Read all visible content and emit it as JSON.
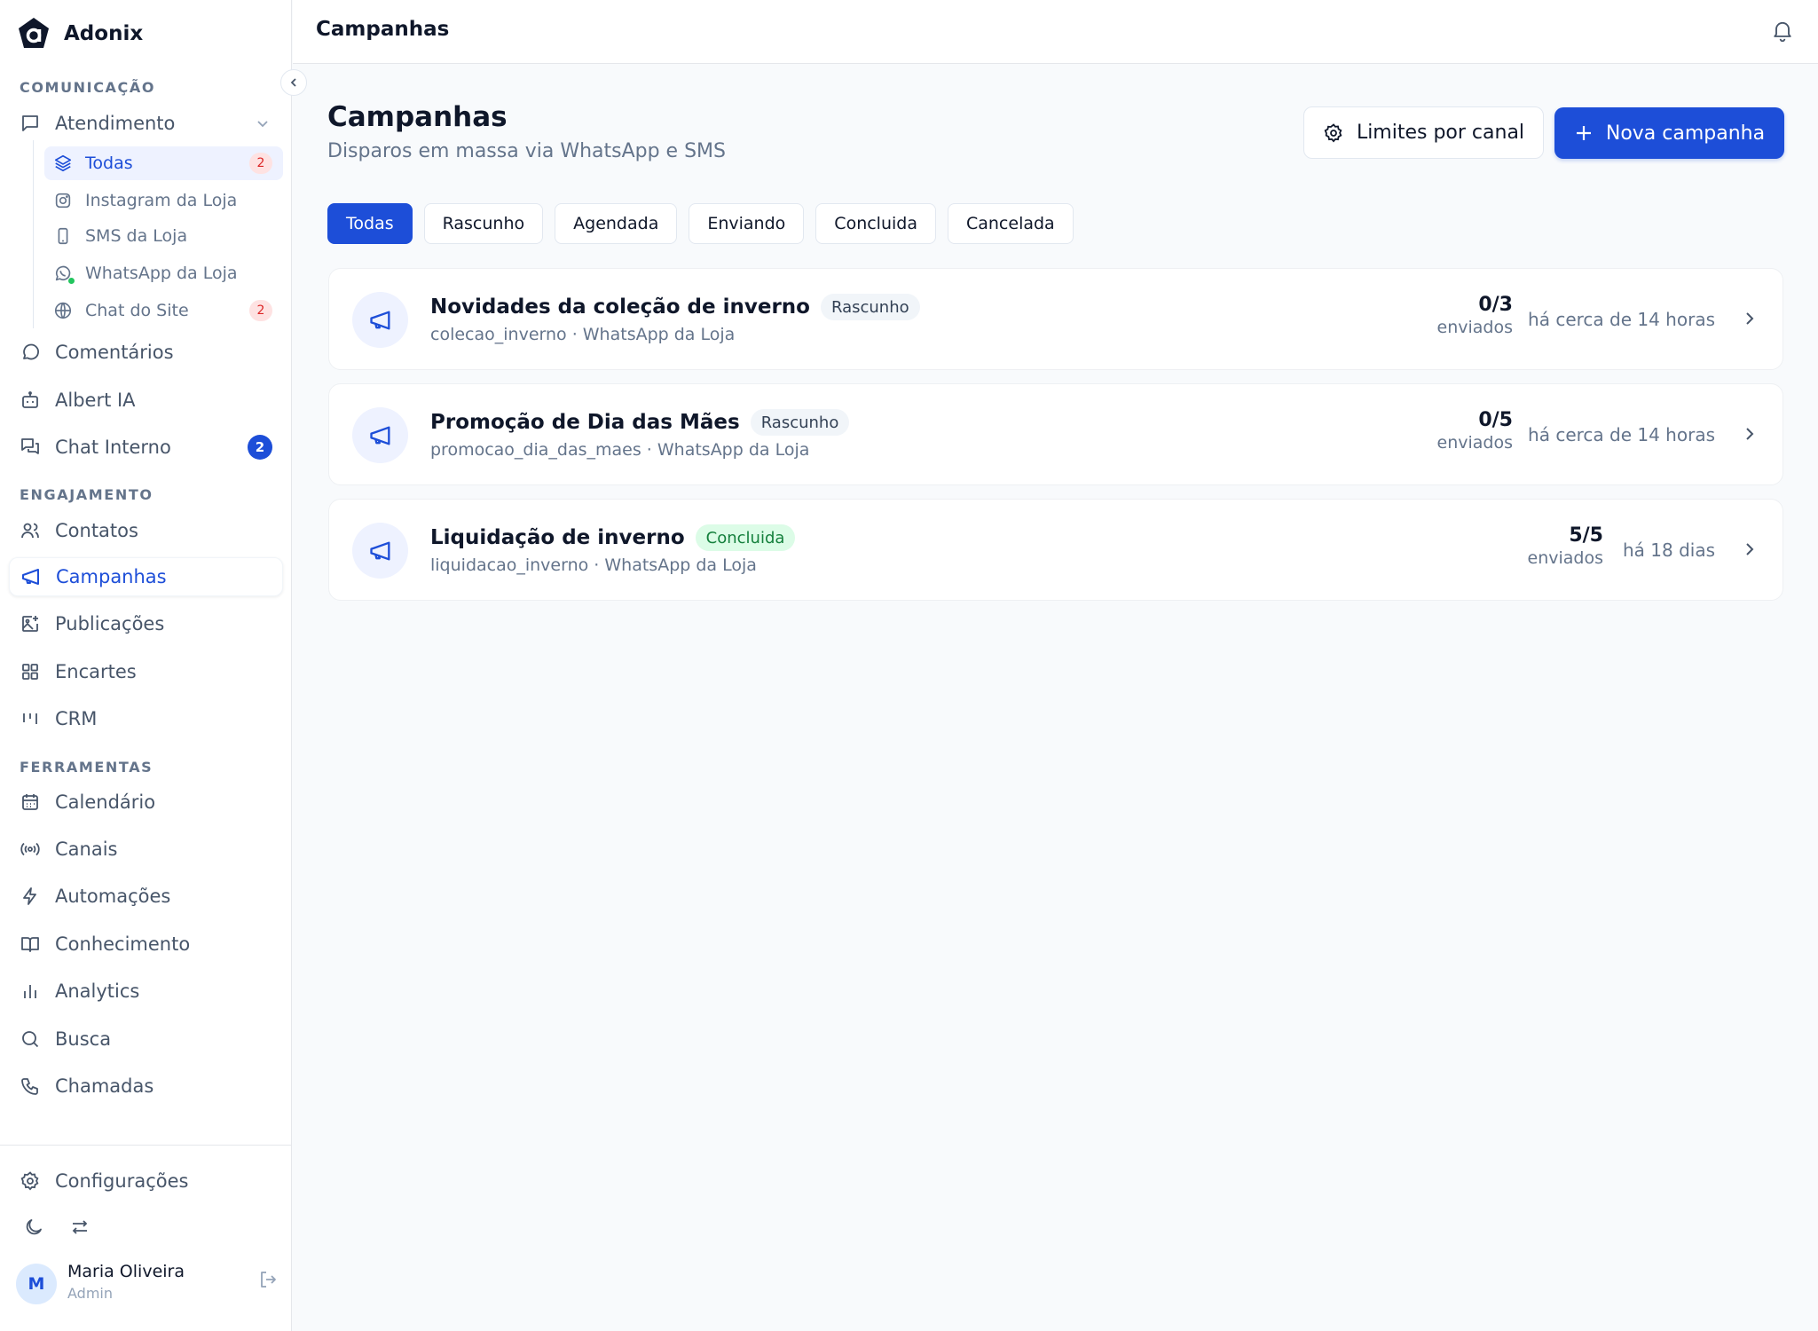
{
  "app": {
    "name": "Adonix"
  },
  "header": {
    "title": "Campanhas"
  },
  "sidebar": {
    "sections": {
      "comunicacao": "COMUNICAÇÃO",
      "engajamento": "ENGAJAMENTO",
      "ferramentas": "FERRAMENTAS"
    },
    "atendimento": {
      "label": "Atendimento",
      "subitems": [
        {
          "label": "Todas",
          "badge": "2",
          "icon": "layers-icon"
        },
        {
          "label": "Instagram da Loja",
          "icon": "instagram-icon"
        },
        {
          "label": "SMS da Loja",
          "icon": "phone-device-icon"
        },
        {
          "label": "WhatsApp da Loja",
          "icon": "whatsapp-icon"
        },
        {
          "label": "Chat do Site",
          "badge": "2",
          "icon": "globe-icon"
        }
      ]
    },
    "items": {
      "comentarios": "Comentários",
      "albert": "Albert IA",
      "chat_interno": "Chat Interno",
      "chat_interno_badge": "2",
      "contatos": "Contatos",
      "campanhas": "Campanhas",
      "publicacoes": "Publicações",
      "encartes": "Encartes",
      "crm": "CRM",
      "calendario": "Calendário",
      "canais": "Canais",
      "automacoes": "Automações",
      "conhecimento": "Conhecimento",
      "analytics": "Analytics",
      "busca": "Busca",
      "chamadas": "Chamadas",
      "configuracoes": "Configurações"
    },
    "user": {
      "initial": "M",
      "name": "Maria Oliveira",
      "role": "Admin"
    }
  },
  "main": {
    "title": "Campanhas",
    "subtitle": "Disparos em massa via WhatsApp e SMS",
    "limits_button": "Limites por canal",
    "new_button": "Nova campanha",
    "tabs": [
      "Todas",
      "Rascunho",
      "Agendada",
      "Enviando",
      "Concluida",
      "Cancelada"
    ],
    "campaigns": [
      {
        "title": "Novidades da coleção de inverno",
        "status": "Rascunho",
        "slug": "colecao_inverno · WhatsApp da Loja",
        "count": "0/3",
        "sent": "enviados",
        "time": "há cerca de 14 horas"
      },
      {
        "title": "Promoção de Dia das Mães",
        "status": "Rascunho",
        "slug": "promocao_dia_das_maes · WhatsApp da Loja",
        "count": "0/5",
        "sent": "enviados",
        "time": "há cerca de 14 horas"
      },
      {
        "title": "Liquidação de inverno",
        "status": "Concluida",
        "slug": "liquidacao_inverno · WhatsApp da Loja",
        "count": "5/5",
        "sent": "enviados",
        "time": "há 18 dias"
      }
    ]
  },
  "colors": {
    "accent": "#1d4ed8",
    "badge_red": "#dc2626",
    "success": "#15803d"
  }
}
